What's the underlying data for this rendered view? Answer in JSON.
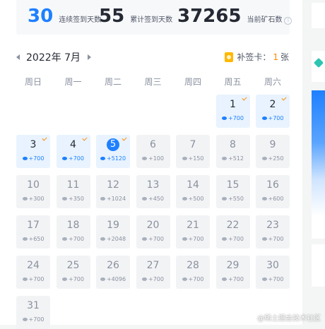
{
  "stats": {
    "consecutive": {
      "value": "30",
      "label": "连续签到天数"
    },
    "total": {
      "value": "55",
      "label": "累计签到天数"
    },
    "ore": {
      "value": "37265",
      "label": "当前矿石数",
      "info_icon": "i"
    }
  },
  "calendar": {
    "month_label": "2022年 7月",
    "repair_card": {
      "label": "补签卡：",
      "count": "1",
      "unit": "张"
    },
    "weekdays": [
      "周日",
      "周一",
      "周二",
      "周三",
      "周四",
      "周五",
      "周六"
    ],
    "days": [
      {
        "day": "1",
        "points": "+700",
        "signed": true
      },
      {
        "day": "2",
        "points": "+700",
        "signed": true
      },
      {
        "day": "3",
        "points": "+700",
        "signed": true
      },
      {
        "day": "4",
        "points": "+700",
        "signed": true
      },
      {
        "day": "5",
        "points": "+5120",
        "signed": true,
        "today": true
      },
      {
        "day": "6",
        "points": "+100",
        "signed": false
      },
      {
        "day": "7",
        "points": "+150",
        "signed": false
      },
      {
        "day": "8",
        "points": "+512",
        "signed": false
      },
      {
        "day": "9",
        "points": "+250",
        "signed": false
      },
      {
        "day": "10",
        "points": "+300",
        "signed": false
      },
      {
        "day": "11",
        "points": "+350",
        "signed": false
      },
      {
        "day": "12",
        "points": "+1024",
        "signed": false
      },
      {
        "day": "13",
        "points": "+450",
        "signed": false
      },
      {
        "day": "14",
        "points": "+500",
        "signed": false
      },
      {
        "day": "15",
        "points": "+550",
        "signed": false
      },
      {
        "day": "16",
        "points": "+600",
        "signed": false
      },
      {
        "day": "17",
        "points": "+650",
        "signed": false
      },
      {
        "day": "18",
        "points": "+700",
        "signed": false
      },
      {
        "day": "19",
        "points": "+2048",
        "signed": false
      },
      {
        "day": "20",
        "points": "+700",
        "signed": false
      },
      {
        "day": "21",
        "points": "+700",
        "signed": false
      },
      {
        "day": "22",
        "points": "+700",
        "signed": false
      },
      {
        "day": "23",
        "points": "+700",
        "signed": false
      },
      {
        "day": "24",
        "points": "+700",
        "signed": false
      },
      {
        "day": "25",
        "points": "+700",
        "signed": false
      },
      {
        "day": "26",
        "points": "+4096",
        "signed": false
      },
      {
        "day": "27",
        "points": "+700",
        "signed": false
      },
      {
        "day": "28",
        "points": "+700",
        "signed": false
      },
      {
        "day": "29",
        "points": "+700",
        "signed": false
      },
      {
        "day": "30",
        "points": "+700",
        "signed": false
      },
      {
        "day": "31",
        "points": "+700",
        "signed": false
      }
    ]
  },
  "icons": {
    "ore": "ore-icon",
    "check": "check-icon",
    "card": "repair-card-icon"
  },
  "colors": {
    "accent": "#1e80ff",
    "signed_bg": "#e8f3ff",
    "check": "#ff8a00",
    "repair_count": "#ff8800"
  },
  "watermark": "@稀土掘金技术社区"
}
